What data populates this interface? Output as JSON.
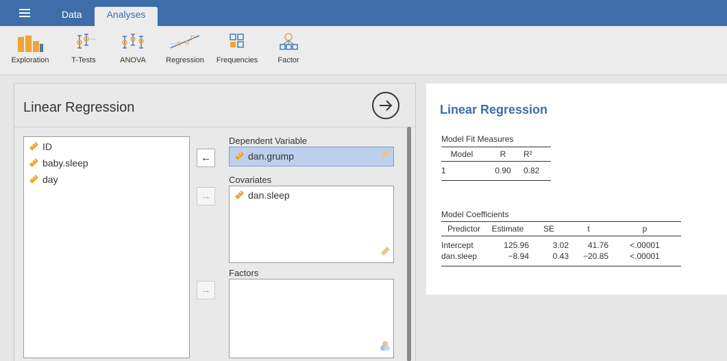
{
  "topbar": {
    "tabs": [
      {
        "label": "Data",
        "active": false
      },
      {
        "label": "Analyses",
        "active": true
      }
    ]
  },
  "ribbon": {
    "buttons": [
      {
        "label": "Exploration",
        "icon": "exploration-icon"
      },
      {
        "label": "T-Tests",
        "icon": "t-tests-icon"
      },
      {
        "label": "ANOVA",
        "icon": "anova-icon"
      },
      {
        "label": "Regression",
        "icon": "regression-icon"
      },
      {
        "label": "Frequencies",
        "icon": "frequencies-icon"
      },
      {
        "label": "Factor",
        "icon": "factor-icon"
      }
    ]
  },
  "analysis_panel": {
    "title": "Linear Regression",
    "variables": [
      "ID",
      "baby.sleep",
      "day"
    ],
    "dependent_label": "Dependent Variable",
    "dependent_value": "dan.grump",
    "covariates_label": "Covariates",
    "covariates": [
      "dan.sleep"
    ],
    "factors_label": "Factors",
    "factors": [],
    "arrows": {
      "dependent": "←",
      "covariates": "→",
      "factors": "→"
    }
  },
  "results": {
    "title": "Linear Regression",
    "model_fit": {
      "title": "Model Fit Measures",
      "headers": [
        "Model",
        "R",
        "R²"
      ],
      "rows": [
        [
          "1",
          "0.90",
          "0.82"
        ]
      ]
    },
    "coefficients": {
      "title": "Model Coefficients",
      "headers": [
        "Predictor",
        "Estimate",
        "SE",
        "t",
        "p"
      ],
      "rows": [
        [
          "Intercept",
          "125.96",
          "3.02",
          "41.76",
          "<.00001"
        ],
        [
          "dan.sleep",
          "−8.94",
          "0.43",
          "−20.85",
          "<.00001"
        ]
      ]
    }
  },
  "colors": {
    "topbar": "#3e6da9",
    "accent_title": "#3e6da9",
    "icon_orange": "#f0a431",
    "icon_blue": "#4b78b8",
    "selected_row": "#bcd0ed"
  }
}
